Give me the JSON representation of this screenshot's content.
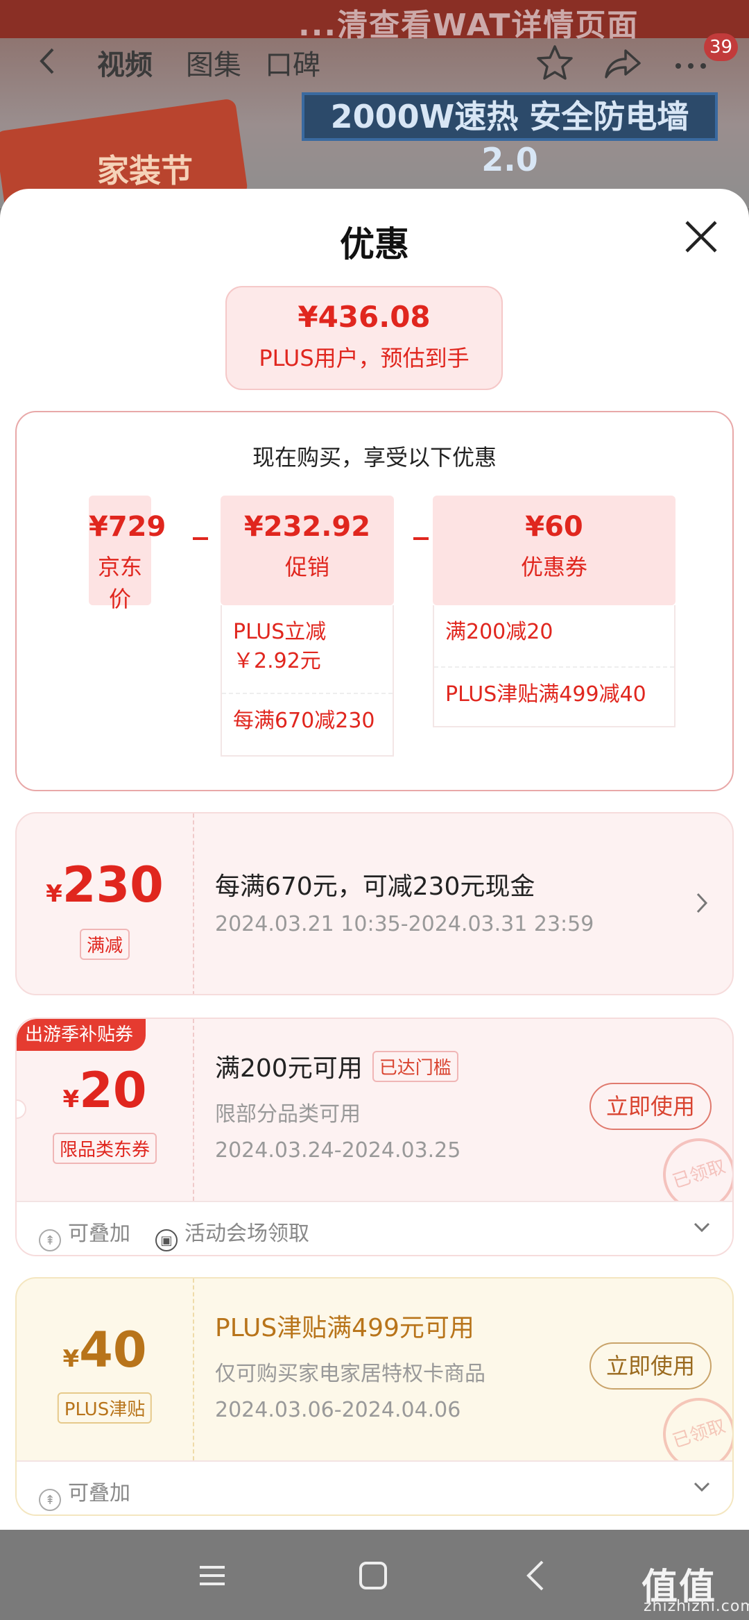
{
  "background": {
    "banner_text": "...清查看WAT详情页面",
    "tabs": [
      "视频",
      "图集",
      "口碑"
    ],
    "notification_count": "39",
    "promo_card_text": "家装节",
    "slogan": "2000W速热 安全防电墙2.0"
  },
  "sheet": {
    "title": "优惠",
    "estimate": {
      "price": "¥436.08",
      "label": "PLUS用户，预估到手"
    },
    "breakdown": {
      "heading": "现在购买，享受以下优惠",
      "items": [
        {
          "value": "¥729",
          "label": "京东价"
        },
        {
          "value": "¥232.92",
          "label": "促销",
          "details": [
            "PLUS立减\n￥2.92元",
            "每满670减230"
          ]
        },
        {
          "value": "¥60",
          "label": "优惠券",
          "details": [
            "满200减20",
            "PLUS津贴满499减40"
          ]
        }
      ]
    },
    "coupons": [
      {
        "currency": "¥",
        "amount": "230",
        "tag": "满减",
        "title": "每满670元，可减230元现金",
        "date": "2024.03.21 10:35-2024.03.31 23:59"
      },
      {
        "ribbon": "出游季补贴券",
        "currency": "¥",
        "amount": "20",
        "tag": "限品类东券",
        "title": "满200元可用",
        "status_tag": "已达门槛",
        "subtitle": "限部分品类可用",
        "date": "2024.03.24-2024.03.25",
        "button": "立即使用",
        "stamp": "已领取",
        "footer": [
          "可叠加",
          "活动会场领取"
        ]
      },
      {
        "currency": "¥",
        "amount": "40",
        "tag": "PLUS津贴",
        "title": "PLUS津贴满499元可用",
        "subtitle": "仅可购买家电家居特权卡商品",
        "date": "2024.03.06-2024.04.06",
        "button": "立即使用",
        "stamp": "已领取",
        "footer": [
          "可叠加"
        ]
      }
    ]
  },
  "watermark": {
    "main": "值值值",
    "sub": "zhizhizhi.com"
  },
  "colors": {
    "accent_red": "#e0261e",
    "gold": "#b8741a",
    "sheet_bg": "#ffffff"
  }
}
